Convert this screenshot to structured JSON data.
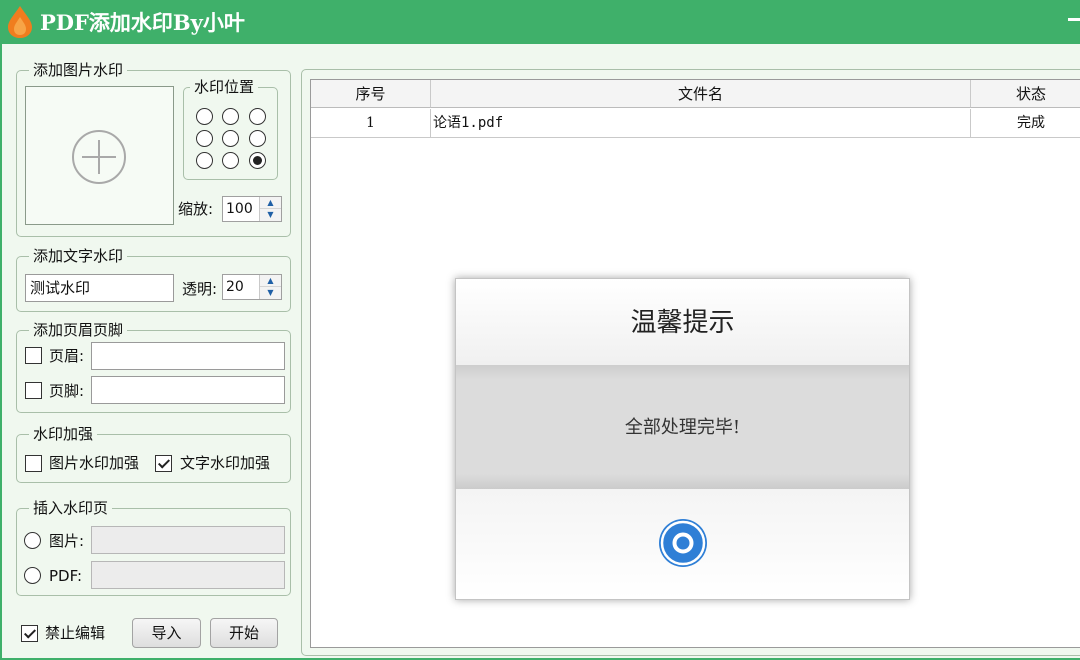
{
  "window": {
    "title": "PDF添加水印By小叶",
    "minimize_label": "—"
  },
  "image_watermark": {
    "legend": "添加图片水印",
    "position": {
      "legend": "水印位置",
      "selected_index": 8
    },
    "scale_label": "缩放:",
    "scale_value": "100"
  },
  "text_watermark": {
    "legend": "添加文字水印",
    "text_value": "测试水印",
    "opacity_label": "透明:",
    "opacity_value": "20"
  },
  "header_footer": {
    "legend": "添加页眉页脚",
    "header_label": "页眉:",
    "header_checked": false,
    "header_value": "",
    "footer_label": "页脚:",
    "footer_checked": false,
    "footer_value": ""
  },
  "enhance": {
    "legend": "水印加强",
    "image_label": "图片水印加强",
    "image_checked": false,
    "text_label": "文字水印加强",
    "text_checked": true
  },
  "insert_page": {
    "legend": "插入水印页",
    "image_label": "图片:",
    "pdf_label": "PDF:",
    "image_value": "",
    "pdf_value": ""
  },
  "bottom": {
    "disable_edit_label": "禁止编辑",
    "disable_edit_checked": true,
    "import_label": "导入",
    "start_label": "开始"
  },
  "file_table": {
    "columns": [
      "序号",
      "文件名",
      "状态"
    ],
    "rows": [
      {
        "index": "1",
        "filename": "论语1.pdf",
        "status": "完成"
      }
    ]
  },
  "dialog": {
    "title": "温馨提示",
    "message": "全部处理完毕!"
  },
  "colors": {
    "titlebar": "#3fb06a",
    "window_bg": "#f0f8ef",
    "ok_button": "#2f7fd6",
    "logo_flame": "#f07d1e"
  },
  "icons": {
    "app_logo": "flame-drop-icon",
    "image_placeholder": "plus-circle-icon",
    "dialog_ok": "ok-circle-icon"
  }
}
